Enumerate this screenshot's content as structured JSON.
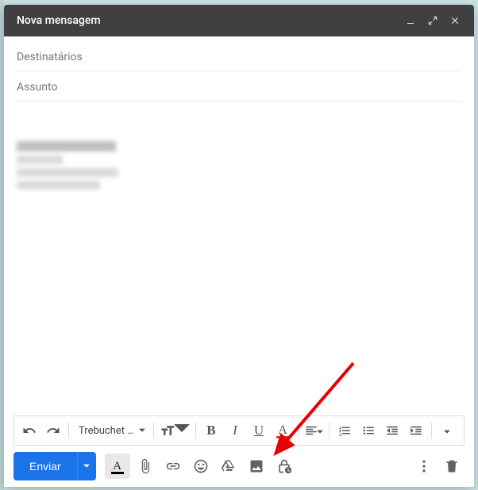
{
  "header": {
    "title": "Nova mensagem"
  },
  "fields": {
    "to_placeholder": "Destinatários",
    "subject_placeholder": "Assunto"
  },
  "toolbar": {
    "font_name": "Trebuchet …",
    "bold": "B",
    "italic": "I",
    "underline": "U",
    "text_color": "A"
  },
  "bottom": {
    "send_label": "Enviar",
    "format_letter": "A"
  }
}
